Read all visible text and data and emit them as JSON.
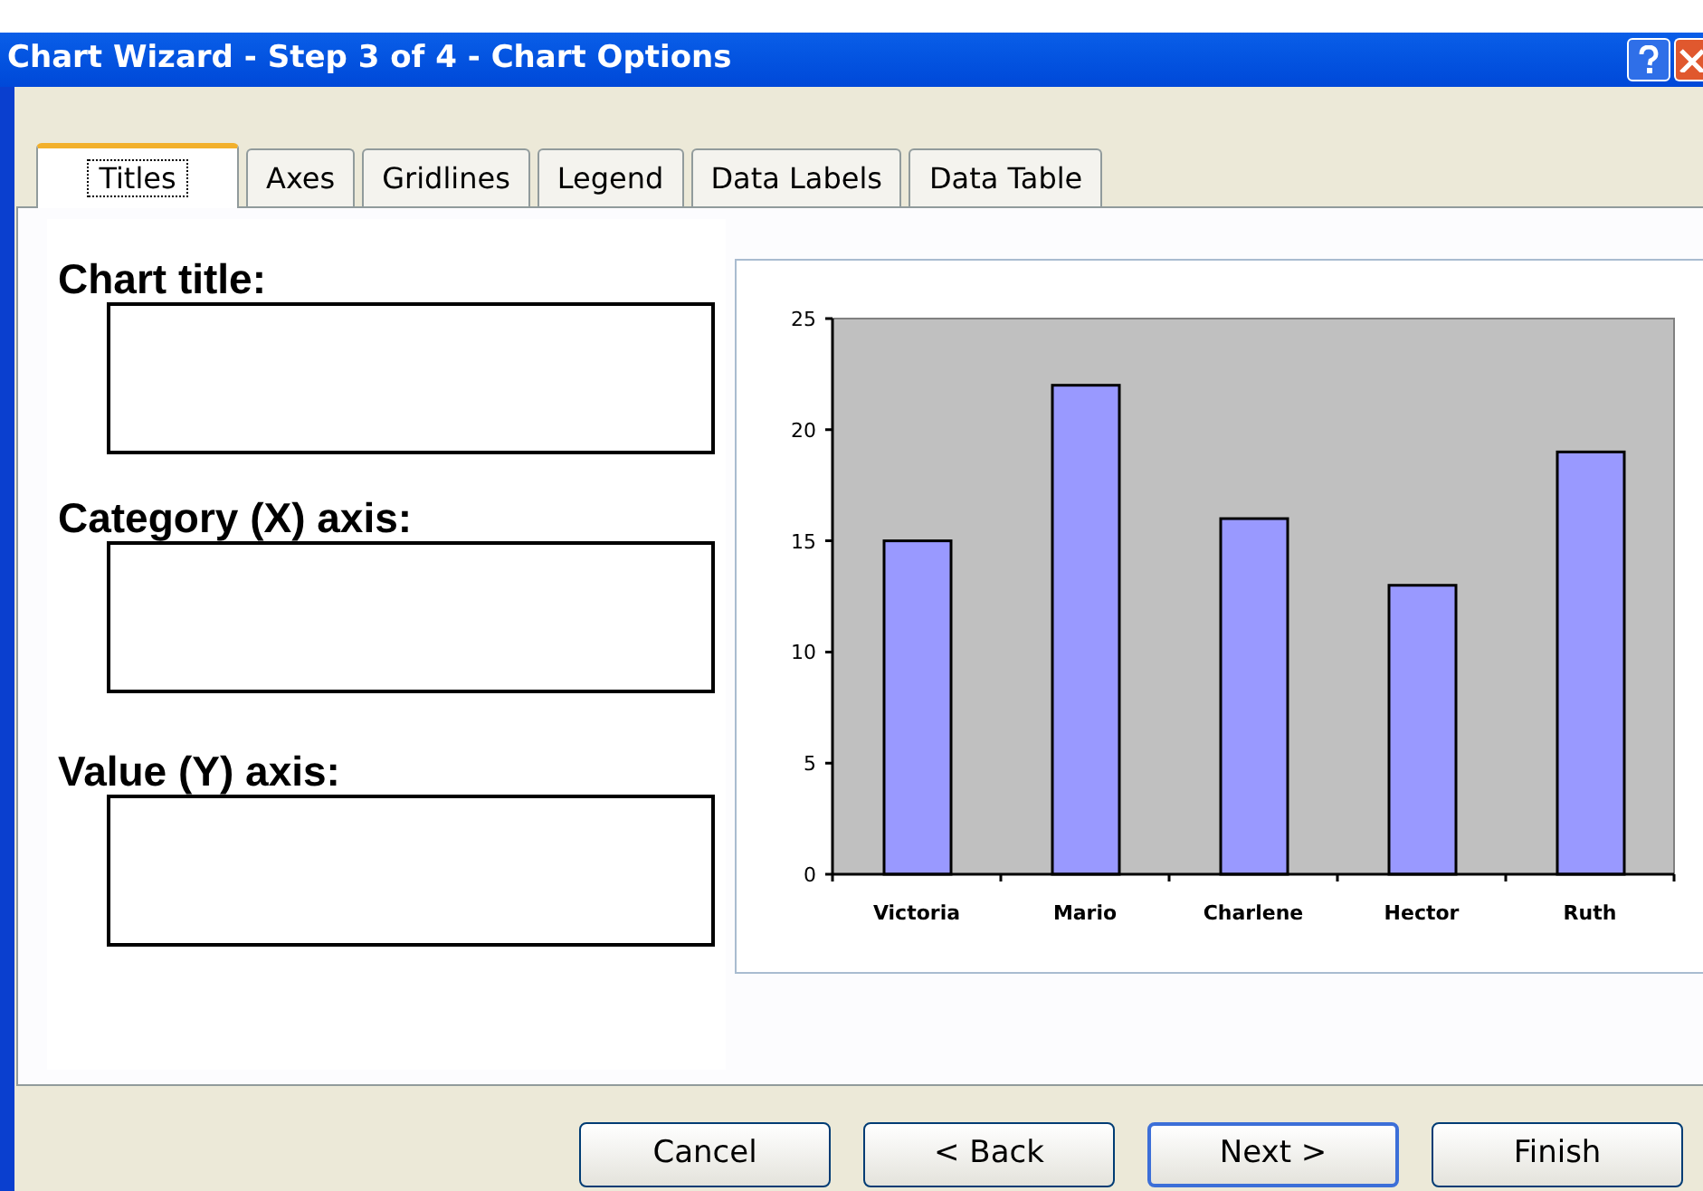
{
  "window": {
    "title": "Chart Wizard - Step 3 of 4 - Chart Options"
  },
  "tabs": [
    {
      "label": "Titles",
      "selected": true
    },
    {
      "label": "Axes",
      "selected": false
    },
    {
      "label": "Gridlines",
      "selected": false
    },
    {
      "label": "Legend",
      "selected": false
    },
    {
      "label": "Data Labels",
      "selected": false
    },
    {
      "label": "Data Table",
      "selected": false
    }
  ],
  "fields": [
    {
      "label": "Chart title:"
    },
    {
      "label": "Category (X) axis:"
    },
    {
      "label": "Value (Y) axis:"
    }
  ],
  "preview": {
    "chart_data": {
      "type": "bar",
      "categories": [
        "Victoria",
        "Mario",
        "Charlene",
        "Hector",
        "Ruth"
      ],
      "series": [
        {
          "color": "#9999ff",
          "values": [
            15,
            22,
            16,
            13,
            19
          ]
        }
      ],
      "ylim": [
        0,
        25
      ],
      "yticks": [
        0,
        5,
        10,
        15,
        20,
        25
      ]
    }
  },
  "buttons": [
    {
      "label": "Cancel",
      "default": false
    },
    {
      "label": "< Back",
      "default": false
    },
    {
      "label": "Next >",
      "default": true
    },
    {
      "label": "Finish",
      "default": false
    }
  ]
}
